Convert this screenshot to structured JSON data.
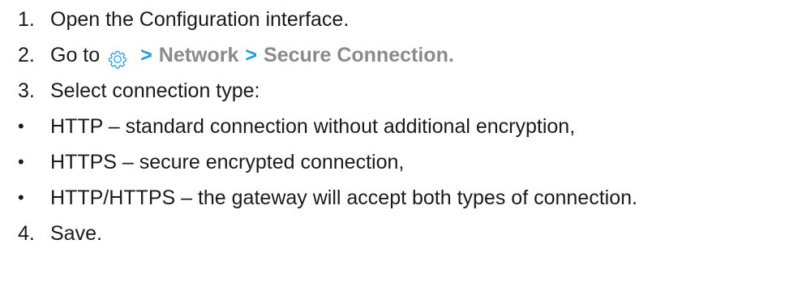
{
  "steps": [
    {
      "num": "1.",
      "text": "Open the Configuration interface."
    },
    {
      "num": "2.",
      "text": "Go to",
      "path": [
        "Network",
        "Secure Connection."
      ],
      "separator": ">"
    },
    {
      "num": "3.",
      "text": "Select connection type:"
    },
    {
      "num": "4.",
      "text": "Save."
    }
  ],
  "bullets": [
    {
      "marker": "•",
      "text": "HTTP – standard connection without additional encryption,"
    },
    {
      "marker": "•",
      "text": "HTTPS – secure encrypted connection,"
    },
    {
      "marker": "•",
      "text": "HTTP/HTTPS – the gateway will accept both types of connection."
    }
  ],
  "icons": {
    "settings": "gear-icon"
  },
  "colors": {
    "separator": "#1a9be6",
    "crumb": "#8a8a8a",
    "gear": "#1a9be6",
    "text": "#1a1a1a"
  }
}
